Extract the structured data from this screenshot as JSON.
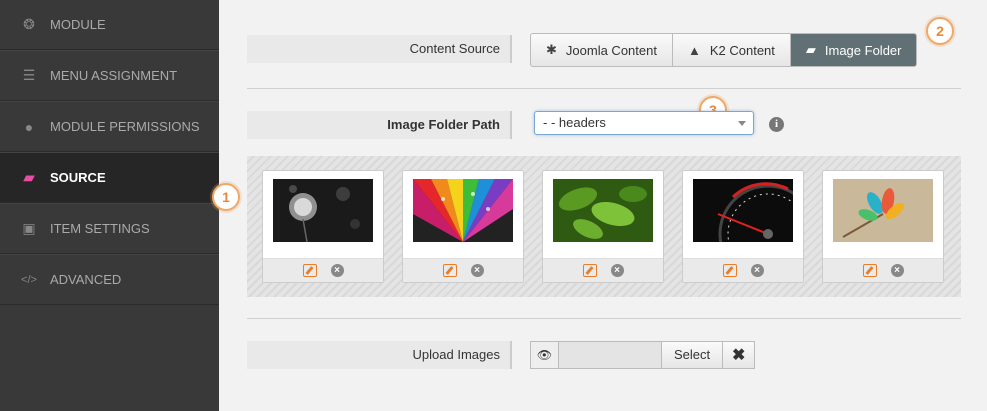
{
  "sidebar": {
    "items": [
      {
        "label": "MODULE",
        "icon": "module-icon",
        "glyph": "❂"
      },
      {
        "label": "MENU ASSIGNMENT",
        "icon": "list-icon",
        "glyph": "☰"
      },
      {
        "label": "MODULE PERMISSIONS",
        "icon": "user-icon",
        "glyph": "●"
      },
      {
        "label": "SOURCE",
        "icon": "folder-open-icon",
        "glyph": "▰"
      },
      {
        "label": "ITEM SETTINGS",
        "icon": "image-icon",
        "glyph": "▣"
      },
      {
        "label": "ADVANCED",
        "icon": "code-icon",
        "glyph": "</>"
      }
    ],
    "active_index": 3
  },
  "callouts": [
    "1",
    "2",
    "3"
  ],
  "content_source": {
    "label": "Content Source",
    "options": [
      {
        "label": "Joomla Content",
        "glyph": "✱"
      },
      {
        "label": "K2 Content",
        "glyph": "▲"
      },
      {
        "label": "Image Folder",
        "glyph": "▰"
      }
    ],
    "selected": "Image Folder"
  },
  "image_folder_path": {
    "label": "Image Folder Path",
    "value": "- - headers",
    "info_glyph": "i"
  },
  "images": [
    {
      "name": "dandelion"
    },
    {
      "name": "rainbow-petals"
    },
    {
      "name": "green-leaves"
    },
    {
      "name": "speedometer"
    },
    {
      "name": "colorful-plant"
    }
  ],
  "upload": {
    "label": "Upload Images",
    "select_label": "Select",
    "eye_glyph": "👁",
    "clear_glyph": "✖"
  },
  "colors": {
    "sidebar_bg": "#393939",
    "active_bg": "#262626",
    "accent_pink": "#e84ea8",
    "accent_orange": "#e8893a",
    "segment_active": "#607075"
  }
}
